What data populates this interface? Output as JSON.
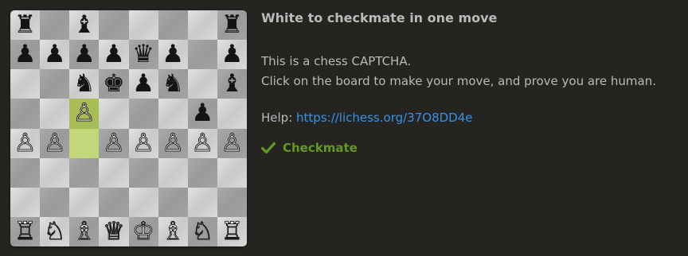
{
  "board": {
    "rows": [
      [
        {
          "p": "♜",
          "c": "black"
        },
        {
          "p": "",
          "c": ""
        },
        {
          "p": "♝",
          "c": "black"
        },
        {
          "p": "",
          "c": ""
        },
        {
          "p": "",
          "c": ""
        },
        {
          "p": "",
          "c": ""
        },
        {
          "p": "",
          "c": ""
        },
        {
          "p": "♜",
          "c": "black"
        }
      ],
      [
        {
          "p": "♟",
          "c": "black"
        },
        {
          "p": "♟",
          "c": "black"
        },
        {
          "p": "♟",
          "c": "black"
        },
        {
          "p": "♟",
          "c": "black"
        },
        {
          "p": "♛",
          "c": "black"
        },
        {
          "p": "♟",
          "c": "black"
        },
        {
          "p": "",
          "c": ""
        },
        {
          "p": "♟",
          "c": "black"
        }
      ],
      [
        {
          "p": "",
          "c": ""
        },
        {
          "p": "",
          "c": ""
        },
        {
          "p": "♞",
          "c": "black"
        },
        {
          "p": "♚",
          "c": "black"
        },
        {
          "p": "♟",
          "c": "black"
        },
        {
          "p": "♞",
          "c": "black"
        },
        {
          "p": "",
          "c": ""
        },
        {
          "p": "♝",
          "c": "black"
        }
      ],
      [
        {
          "p": "",
          "c": ""
        },
        {
          "p": "",
          "c": ""
        },
        {
          "p": "♙",
          "c": "white"
        },
        {
          "p": "",
          "c": ""
        },
        {
          "p": "",
          "c": ""
        },
        {
          "p": "",
          "c": ""
        },
        {
          "p": "♟",
          "c": "black"
        },
        {
          "p": "",
          "c": ""
        }
      ],
      [
        {
          "p": "♙",
          "c": "white"
        },
        {
          "p": "♙",
          "c": "white"
        },
        {
          "p": "",
          "c": ""
        },
        {
          "p": "♙",
          "c": "white"
        },
        {
          "p": "♙",
          "c": "white"
        },
        {
          "p": "♙",
          "c": "white"
        },
        {
          "p": "♙",
          "c": "white"
        },
        {
          "p": "♙",
          "c": "white"
        }
      ],
      [
        {
          "p": "",
          "c": ""
        },
        {
          "p": "",
          "c": ""
        },
        {
          "p": "",
          "c": ""
        },
        {
          "p": "",
          "c": ""
        },
        {
          "p": "",
          "c": ""
        },
        {
          "p": "",
          "c": ""
        },
        {
          "p": "",
          "c": ""
        },
        {
          "p": "",
          "c": ""
        }
      ],
      [
        {
          "p": "",
          "c": ""
        },
        {
          "p": "",
          "c": ""
        },
        {
          "p": "",
          "c": ""
        },
        {
          "p": "",
          "c": ""
        },
        {
          "p": "",
          "c": ""
        },
        {
          "p": "",
          "c": ""
        },
        {
          "p": "",
          "c": ""
        },
        {
          "p": "",
          "c": ""
        }
      ],
      [
        {
          "p": "♖",
          "c": "white"
        },
        {
          "p": "♘",
          "c": "white"
        },
        {
          "p": "♗",
          "c": "white"
        },
        {
          "p": "♕",
          "c": "white"
        },
        {
          "p": "♔",
          "c": "white"
        },
        {
          "p": "♗",
          "c": "white"
        },
        {
          "p": "♘",
          "c": "white"
        },
        {
          "p": "♖",
          "c": "white"
        }
      ]
    ],
    "highlighted_squares": [
      "c5",
      "c4"
    ]
  },
  "panel": {
    "title": "White to checkmate in one move",
    "line1": "This is a chess CAPTCHA.",
    "line2": "Click on the board to make your move, and prove you are human.",
    "help_label": "Help: ",
    "help_link": "https://lichess.org/37O8DD4e",
    "status_icon": "check-icon",
    "status_text": "Checkmate"
  },
  "colors": {
    "background": "#262421",
    "text": "#bababa",
    "link": "#3692e7",
    "success": "#629924",
    "highlight_light": "#c3d67a",
    "highlight_dark": "#a9bd56"
  }
}
